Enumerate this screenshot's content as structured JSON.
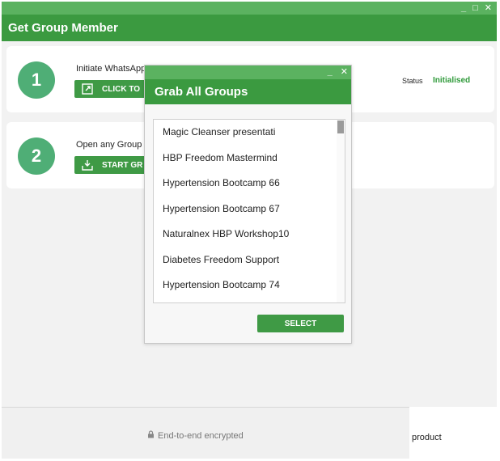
{
  "window": {
    "title": "Get Group Member",
    "controls": {
      "minimize": "_",
      "maximize": "□",
      "close": "✕"
    }
  },
  "steps": [
    {
      "number": "1",
      "text": "Initiate WhatsApp",
      "button_label": "CLICK TO"
    },
    {
      "number": "2",
      "text": "Open any Group c",
      "button_label": "START GR"
    }
  ],
  "status": {
    "label": "Status",
    "value": "Initialised"
  },
  "bottom": {
    "encrypted_text": "End-to-end encrypted",
    "right_text": "product"
  },
  "dialog": {
    "title": "Grab All Groups",
    "controls": {
      "minimize": "_",
      "close": "✕"
    },
    "groups": [
      "Magic Cleanser presentati",
      "HBP Freedom Mastermind",
      "Hypertension Bootcamp 66",
      "Hypertension Bootcamp 67",
      "Naturalnex HBP Workshop10",
      "Diabetes Freedom Support",
      "Hypertension Bootcamp 74"
    ],
    "select_label": "SELECT"
  },
  "colors": {
    "titlebar": "#5bb260",
    "header": "#3b9a40",
    "button": "#3f9a45",
    "step_circle": "#4fae76",
    "status_value": "#2f9a3a"
  },
  "icons": {
    "step1_button": "external-link-icon",
    "step2_button": "download-tray-icon",
    "encrypted": "lock-icon"
  }
}
